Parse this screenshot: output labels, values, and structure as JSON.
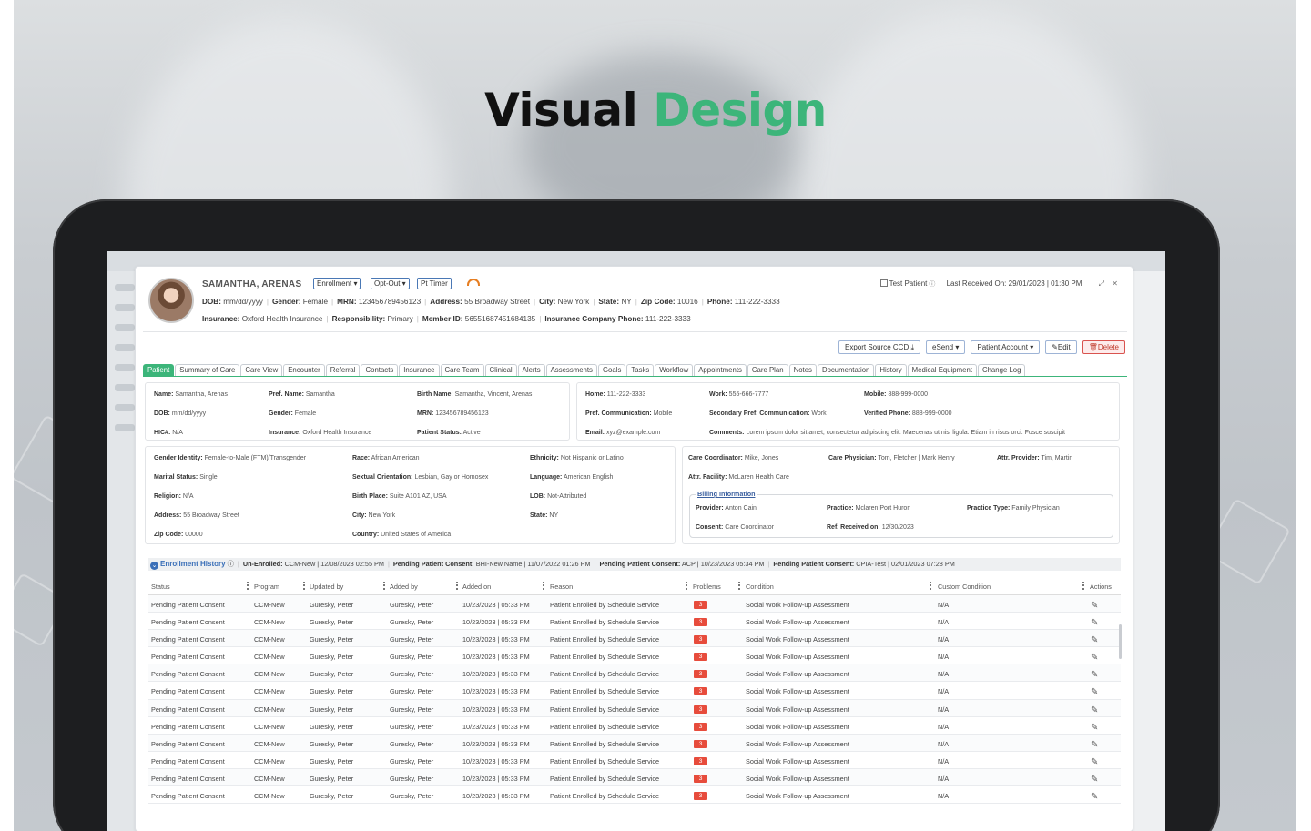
{
  "headline": {
    "word1": "Visual",
    "word2": "Design"
  },
  "colors": {
    "accent": "#3cb57a",
    "link": "#3a6fb8",
    "danger": "#e74c3c"
  },
  "patient": {
    "name": "SAMANTHA, ARENAS",
    "pills": [
      "Enrollment ▾",
      "Opt-Out ▾",
      "Pt Timer"
    ],
    "test_patient": "Test Patient",
    "last_received": "Last Received On: 29/01/2023 | 01:30 PM",
    "line1": [
      {
        "k": "DOB:",
        "v": "mm/dd/yyyy"
      },
      {
        "k": "Gender:",
        "v": "Female"
      },
      {
        "k": "MRN:",
        "v": "123456789456123"
      },
      {
        "k": "Address:",
        "v": "55 Broadway Street"
      },
      {
        "k": "City:",
        "v": "New York"
      },
      {
        "k": "State:",
        "v": "NY"
      },
      {
        "k": "Zip Code:",
        "v": "10016"
      },
      {
        "k": "Phone:",
        "v": "111-222-3333"
      }
    ],
    "line2": [
      {
        "k": "Insurance:",
        "v": "Oxford Health Insurance"
      },
      {
        "k": "Responsibility:",
        "v": "Primary"
      },
      {
        "k": "Member ID:",
        "v": "56551687451684135"
      },
      {
        "k": "Insurance Company Phone:",
        "v": "111-222-3333"
      }
    ]
  },
  "actions": [
    "Export Source CCD ⤓",
    "eSend ▾",
    "Patient Account ▾",
    "✎Edit",
    "🗑Delete"
  ],
  "tabs": [
    "Patient",
    "Summary of Care",
    "Care View",
    "Encounter",
    "Referral",
    "Contacts",
    "Insurance",
    "Care Team",
    "Clinical",
    "Alerts",
    "Assessments",
    "Goals",
    "Tasks",
    "Workflow",
    "Appointments",
    "Care Plan",
    "Notes",
    "Documentation",
    "History",
    "Medical Equipment",
    "Change Log"
  ],
  "box1": [
    {
      "k": "Name:",
      "v": "Samantha, Arenas"
    },
    {
      "k": "Pref. Name:",
      "v": "Samantha"
    },
    {
      "k": "Birth Name:",
      "v": "Samantha, Vincent, Arenas"
    },
    {
      "k": "DOB:",
      "v": "mm/dd/yyyy"
    },
    {
      "k": "Gender:",
      "v": "Female"
    },
    {
      "k": "MRN:",
      "v": "123456789456123"
    },
    {
      "k": "HIC#:",
      "v": "N/A"
    },
    {
      "k": "Insurance:",
      "v": "Oxford Health Insurance"
    },
    {
      "k": "Patient Status:",
      "v": "Active"
    }
  ],
  "box2": [
    {
      "k": "Home:",
      "v": "111-222-3333"
    },
    {
      "k": "Work:",
      "v": "555-666-7777"
    },
    {
      "k": "Mobile:",
      "v": "888-999-0000"
    },
    {
      "k": "Pref. Communication:",
      "v": "Mobile"
    },
    {
      "k": "Secondary Pref. Communication:",
      "v": "Work"
    },
    {
      "k": "Verified Phone:",
      "v": "888-999-0000"
    },
    {
      "k": "Email:",
      "v": "xyz@example.com"
    },
    {
      "k": "Comments:",
      "v": "Lorem ipsum dolor sit amet, consectetur adipiscing elit. Maecenas ut nisl ligula. Etiam in risus orci. Fusce suscipit"
    }
  ],
  "box3": [
    {
      "k": "Gender Identity:",
      "v": "Female-to-Male (FTM)/Transgender"
    },
    {
      "k": "Race:",
      "v": "African American"
    },
    {
      "k": "Ethnicity:",
      "v": "Not Hispanic or Latino"
    },
    {
      "k": "Marital Status:",
      "v": "Single"
    },
    {
      "k": "Sextual Orientation:",
      "v": "Lesbian, Gay or Homosex"
    },
    {
      "k": "Language:",
      "v": "American English"
    },
    {
      "k": "Religion:",
      "v": "N/A"
    },
    {
      "k": "Birth Place:",
      "v": "Suite A101 AZ, USA"
    },
    {
      "k": "LOB:",
      "v": "Not-Attributed"
    },
    {
      "k": "Address:",
      "v": "55 Broadway Street"
    },
    {
      "k": "City:",
      "v": "New York"
    },
    {
      "k": "State:",
      "v": "NY"
    },
    {
      "k": "Zip Code:",
      "v": "00000"
    },
    {
      "k": "Country:",
      "v": "United States of America"
    }
  ],
  "box4": [
    {
      "k": "Care Coordinator:",
      "v": "Mike, Jones"
    },
    {
      "k": "Care Physician:",
      "v": "Tom, Fletcher | Mark Henry"
    },
    {
      "k": "Attr. Provider:",
      "v": "Tim, Martin"
    },
    {
      "k": "Attr. Facility:",
      "v": "McLaren Health Care"
    }
  ],
  "billing": {
    "legend": "Billing Information",
    "fields": [
      {
        "k": "Provider:",
        "v": "Anton Cain"
      },
      {
        "k": "Practice:",
        "v": "Mclaren Port Huron"
      },
      {
        "k": "Practice Type:",
        "v": "Family Physician"
      },
      {
        "k": "Consent:",
        "v": "Care Coordinator"
      },
      {
        "k": "Ref. Received on:",
        "v": "12/30/2023"
      }
    ]
  },
  "enrollment": {
    "title": "Enrollment History",
    "items": [
      {
        "k": "Un-Enrolled:",
        "v": "CCM-New | 12/08/2023 02:55 PM"
      },
      {
        "k": "Pending Patient Consent:",
        "v": "BHI-New Name | 11/07/2022 01:26 PM"
      },
      {
        "k": "Pending Patient Consent:",
        "v": "ACP | 10/23/2023 05:34 PM"
      },
      {
        "k": "Pending Patient Consent:",
        "v": "CPIA-Test | 02/01/2023 07:28 PM"
      }
    ]
  },
  "table": {
    "columns": [
      "Status",
      "Program",
      "Updated by",
      "Added by",
      "Added on",
      "Reason",
      "Problems",
      "Condition",
      "Custom Condition",
      "Actions"
    ],
    "rows": [
      [
        "Pending Patient Consent",
        "CCM-New",
        "Guresky, Peter",
        "Guresky, Peter",
        "10/23/2023 | 05:33 PM",
        "Patient Enrolled by Schedule Service",
        "3",
        "Social Work Follow-up Assessment",
        "N/A"
      ],
      [
        "Pending Patient Consent",
        "CCM-New",
        "Guresky, Peter",
        "Guresky, Peter",
        "10/23/2023 | 05:33 PM",
        "Patient Enrolled by Schedule Service",
        "3",
        "Social Work Follow-up Assessment",
        "N/A"
      ],
      [
        "Pending Patient Consent",
        "CCM-New",
        "Guresky, Peter",
        "Guresky, Peter",
        "10/23/2023 | 05:33 PM",
        "Patient Enrolled by Schedule Service",
        "3",
        "Social Work Follow-up Assessment",
        "N/A"
      ],
      [
        "Pending Patient Consent",
        "CCM-New",
        "Guresky, Peter",
        "Guresky, Peter",
        "10/23/2023 | 05:33 PM",
        "Patient Enrolled by Schedule Service",
        "3",
        "Social Work Follow-up Assessment",
        "N/A"
      ],
      [
        "Pending Patient Consent",
        "CCM-New",
        "Guresky, Peter",
        "Guresky, Peter",
        "10/23/2023 | 05:33 PM",
        "Patient Enrolled by Schedule Service",
        "3",
        "Social Work Follow-up Assessment",
        "N/A"
      ],
      [
        "Pending Patient Consent",
        "CCM-New",
        "Guresky, Peter",
        "Guresky, Peter",
        "10/23/2023 | 05:33 PM",
        "Patient Enrolled by Schedule Service",
        "3",
        "Social Work Follow-up Assessment",
        "N/A"
      ],
      [
        "Pending Patient Consent",
        "CCM-New",
        "Guresky, Peter",
        "Guresky, Peter",
        "10/23/2023 | 05:33 PM",
        "Patient Enrolled by Schedule Service",
        "3",
        "Social Work Follow-up Assessment",
        "N/A"
      ],
      [
        "Pending Patient Consent",
        "CCM-New",
        "Guresky, Peter",
        "Guresky, Peter",
        "10/23/2023 | 05:33 PM",
        "Patient Enrolled by Schedule Service",
        "3",
        "Social Work Follow-up Assessment",
        "N/A"
      ],
      [
        "Pending Patient Consent",
        "CCM-New",
        "Guresky, Peter",
        "Guresky, Peter",
        "10/23/2023 | 05:33 PM",
        "Patient Enrolled by Schedule Service",
        "3",
        "Social Work Follow-up Assessment",
        "N/A"
      ],
      [
        "Pending Patient Consent",
        "CCM-New",
        "Guresky, Peter",
        "Guresky, Peter",
        "10/23/2023 | 05:33 PM",
        "Patient Enrolled by Schedule Service",
        "3",
        "Social Work Follow-up Assessment",
        "N/A"
      ],
      [
        "Pending Patient Consent",
        "CCM-New",
        "Guresky, Peter",
        "Guresky, Peter",
        "10/23/2023 | 05:33 PM",
        "Patient Enrolled by Schedule Service",
        "3",
        "Social Work Follow-up Assessment",
        "N/A"
      ],
      [
        "Pending Patient Consent",
        "CCM-New",
        "Guresky, Peter",
        "Guresky, Peter",
        "10/23/2023 | 05:33 PM",
        "Patient Enrolled by Schedule Service",
        "3",
        "Social Work Follow-up Assessment",
        "N/A"
      ]
    ]
  }
}
